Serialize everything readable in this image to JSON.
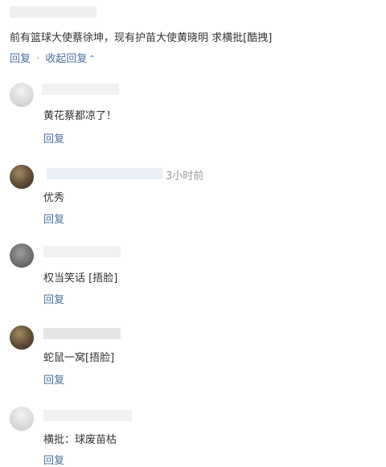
{
  "top_comment": {
    "text": "前有篮球大使蔡徐坤，现有护苗大使黄晓明 求横批[酷拽]",
    "reply_label": "回复",
    "separator": "·",
    "collapse_label": "收起回复",
    "collapse_icon": "chevron-up-icon"
  },
  "replies": [
    {
      "meta": "",
      "text": "黄花蔡都凉了！",
      "reply_label": "回复"
    },
    {
      "meta": "3小时前",
      "text": "优秀",
      "reply_label": "回复"
    },
    {
      "meta": "",
      "text": "权当笑话 [捂脸]",
      "reply_label": "回复"
    },
    {
      "meta": "",
      "text": "蛇鼠一窝[捂脸]",
      "reply_label": "回复"
    },
    {
      "meta": "",
      "text": "横批：球废苗枯",
      "reply_label": "回复"
    }
  ],
  "colors": {
    "link": "#4b6f9c",
    "text": "#333333",
    "meta": "#9a9a9a"
  }
}
